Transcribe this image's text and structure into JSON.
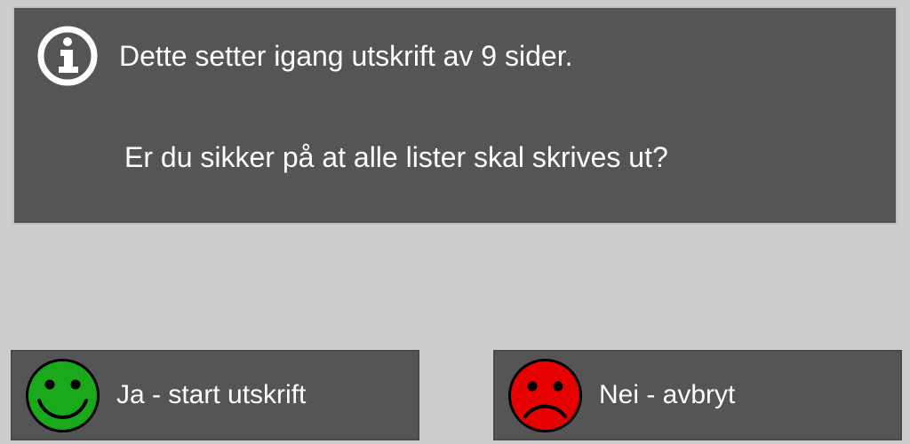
{
  "message": {
    "line1": "Dette setter igang utskrift av 9 sider.",
    "line2": "Er du sikker på at alle lister skal skrives ut?"
  },
  "buttons": {
    "yes_label": "Ja - start utskrift",
    "no_label": "Nei - avbryt"
  },
  "colors": {
    "panel": "#555555",
    "bg": "#cdcdcd",
    "yes_face": "#19a91b",
    "no_face": "#e60000"
  }
}
